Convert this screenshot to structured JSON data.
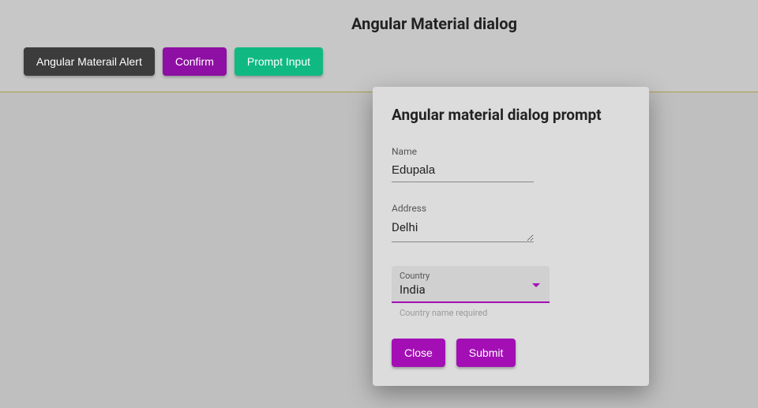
{
  "header": {
    "title": "Angular Material dialog"
  },
  "buttons": {
    "alert": "Angular Materail Alert",
    "confirm": "Confirm",
    "prompt": "Prompt Input"
  },
  "dialog": {
    "title": "Angular material dialog prompt",
    "fields": {
      "name": {
        "label": "Name",
        "value": "Edupala"
      },
      "address": {
        "label": "Address",
        "value": "Delhi"
      },
      "country": {
        "label": "Country",
        "value": "India",
        "hint": "Country name required"
      }
    },
    "actions": {
      "close": "Close",
      "submit": "Submit"
    }
  }
}
